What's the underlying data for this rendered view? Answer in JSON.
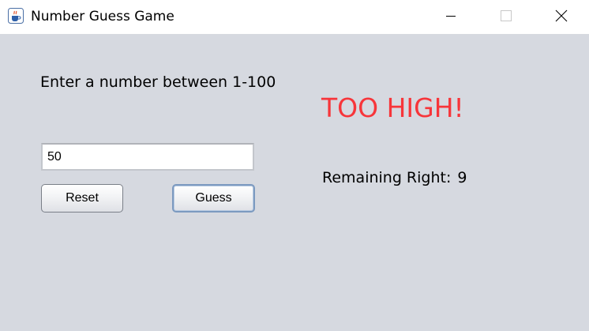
{
  "window": {
    "title": "Number Guess Game",
    "icon": "java-cup-icon",
    "controls": [
      "minimize-icon",
      "maximize-icon",
      "close-icon"
    ]
  },
  "form": {
    "prompt": "Enter a number between 1-100",
    "guess_value": "50",
    "reset_label": "Reset",
    "guess_label": "Guess"
  },
  "status": {
    "result": "TOO HIGH!",
    "result_color": "#f7353a",
    "remaining_label": "Remaining Right:",
    "remaining_count": "9"
  },
  "colors": {
    "background": "#d6d9e0",
    "titlebar": "#ffffff",
    "focus_border": "#7c9ac0"
  }
}
